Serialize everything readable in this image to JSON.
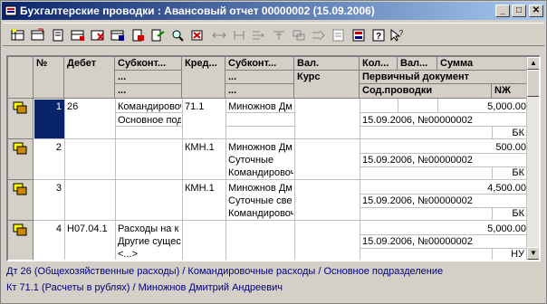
{
  "window": {
    "title": "Бухгалтерские проводки : Авансовый отчет 00000002 (15.09.2006)",
    "controls": [
      "_",
      "□",
      "✕"
    ]
  },
  "toolbar": {
    "icons": [
      "new-row-icon",
      "copy-row-icon",
      "edit-row-icon",
      "add-group-icon",
      "delete-mark-icon",
      "delete-icon",
      "print-icon",
      "filter-icon",
      "search-icon",
      "filter-off-icon",
      "split-icon",
      "move-icon",
      "merge-icon",
      "order-icon",
      "tree-icon",
      "export-icon",
      "report-icon",
      "info-icon",
      "help-icon",
      "whats-this-icon"
    ]
  },
  "table": {
    "headers": {
      "num": "№",
      "debit": "Дебет",
      "subconto1": "Субконт...",
      "subconto1_sub1": "...",
      "subconto1_sub2": "...",
      "credit": "Кред...",
      "subconto2": "Субконт...",
      "subconto2_sub1": "...",
      "subconto2_sub2": "...",
      "currency": "Вал.",
      "rate": "Курс",
      "qty": "Кол...",
      "valamt": "Вал...",
      "amount": "Сумма",
      "primary_doc": "Первичный документ",
      "entry_content": "Сод.проводки",
      "journal_num": "NЖ"
    },
    "rows": [
      {
        "num": "1",
        "debit": "26",
        "sub1": [
          "Командировоч",
          "Основное подр"
        ],
        "credit": "71.1",
        "sub2": [
          "Миножнов Дм",
          ""
        ],
        "amount": "5,000.00",
        "doc": "15.09.2006, №00000002",
        "journal": "БК"
      },
      {
        "num": "2",
        "debit": "",
        "sub1": [
          "",
          ""
        ],
        "credit": "КМН.1",
        "sub2": [
          "Миножнов Дм",
          "Суточные",
          "Командировочн"
        ],
        "amount": "500.00",
        "doc": "15.09.2006, №00000002",
        "journal": "БК"
      },
      {
        "num": "3",
        "debit": "",
        "sub1": [
          "",
          ""
        ],
        "credit": "КМН.1",
        "sub2": [
          "Миножнов Дм",
          "Суточные све",
          "Командировочн"
        ],
        "amount": "4,500.00",
        "doc": "15.09.2006, №00000002",
        "journal": "БК"
      },
      {
        "num": "4",
        "debit": "Н07.04.1",
        "sub1": [
          "Расходы на к",
          "Другие сущес",
          "<...>"
        ],
        "credit": "",
        "sub2": [
          "",
          ""
        ],
        "amount": "5,000.00",
        "doc": "15.09.2006, №00000002",
        "journal": "НУ"
      }
    ]
  },
  "status": {
    "line1": "Дт 26 (Общехозяйственные расходы) / Командировочные расходы / Основное подразделение",
    "line2": "Кт 71.1 (Расчеты в рублях) / Миножнов Дмитрий Андреевич"
  },
  "colors": {
    "title_start": "#0a246a",
    "title_end": "#a6caf0",
    "selection": "#0a246a",
    "status_text": "#000080"
  }
}
